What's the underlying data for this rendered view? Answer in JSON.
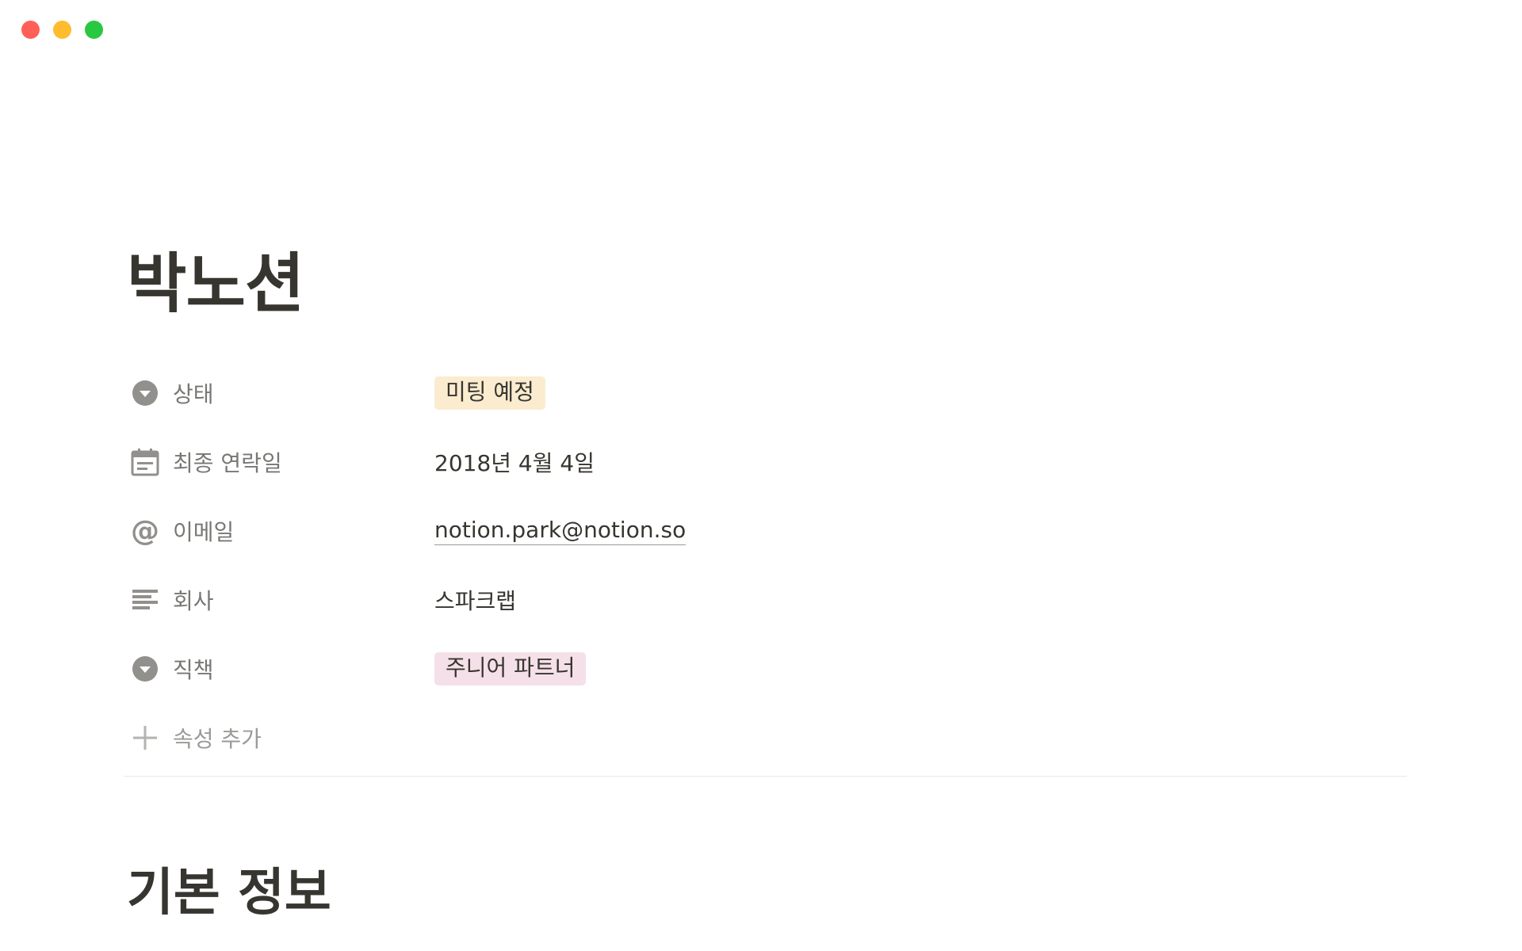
{
  "window": {
    "controls": [
      "close",
      "minimize",
      "maximize"
    ],
    "colors": {
      "close": "#ff5f57",
      "minimize": "#febc2e",
      "maximize": "#28c840"
    }
  },
  "page": {
    "title": "박노션",
    "properties": [
      {
        "icon": "select-icon",
        "label": "상태",
        "type": "select",
        "value": "미팅 예정",
        "tag_color": "#fbecd0"
      },
      {
        "icon": "calendar-icon",
        "label": "최종 연락일",
        "type": "date",
        "value": "2018년 4월 4일"
      },
      {
        "icon": "at-sign-icon",
        "label": "이메일",
        "type": "email",
        "value": "notion.park@notion.so"
      },
      {
        "icon": "text-lines-icon",
        "label": "회사",
        "type": "text",
        "value": "스파크랩"
      },
      {
        "icon": "select-icon",
        "label": "직책",
        "type": "select",
        "value": "주니어 파트너",
        "tag_color": "#f5e0e9"
      }
    ],
    "add_property_label": "속성 추가",
    "section_heading": "기본 정보"
  }
}
